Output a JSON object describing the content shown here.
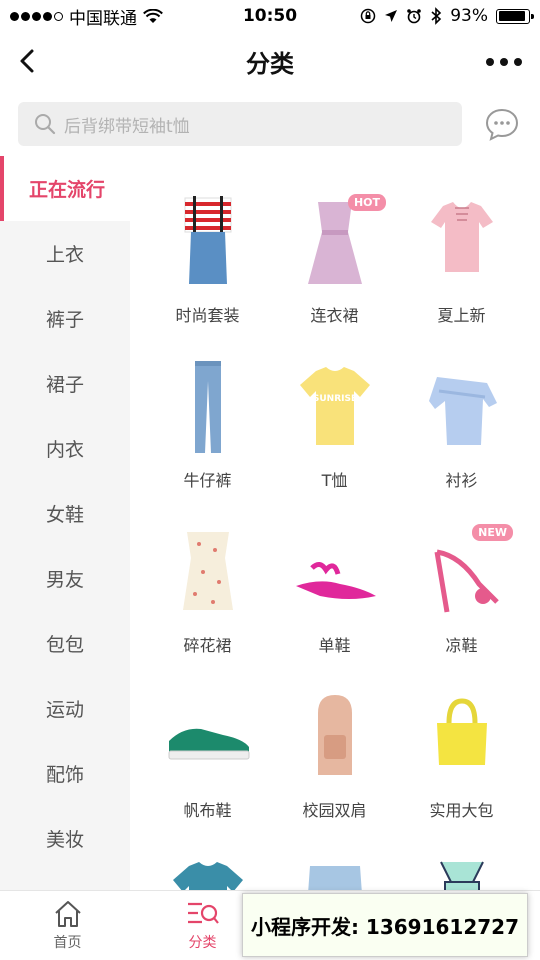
{
  "status_bar": {
    "carrier": "中国联通",
    "time": "10:50",
    "battery": "93%",
    "battery_level": 0.93
  },
  "nav": {
    "title": "分类"
  },
  "search": {
    "placeholder": "后背绑带短袖t恤"
  },
  "sidebar": {
    "items": [
      {
        "label": "正在流行",
        "active": true
      },
      {
        "label": "上衣"
      },
      {
        "label": "裤子"
      },
      {
        "label": "裙子"
      },
      {
        "label": "内衣"
      },
      {
        "label": "女鞋"
      },
      {
        "label": "男友"
      },
      {
        "label": "包包"
      },
      {
        "label": "运动"
      },
      {
        "label": "配饰"
      },
      {
        "label": "美妆"
      }
    ]
  },
  "grid": {
    "items": [
      {
        "label": "时尚套装",
        "icon": "outfit-icon"
      },
      {
        "label": "连衣裙",
        "icon": "dress-icon",
        "tag": "HOT"
      },
      {
        "label": "夏上新",
        "icon": "pink-top-icon"
      },
      {
        "label": "牛仔裤",
        "icon": "jeans-icon"
      },
      {
        "label": "T恤",
        "icon": "tshirt-icon"
      },
      {
        "label": "衬衫",
        "icon": "shirt-icon"
      },
      {
        "label": "碎花裙",
        "icon": "floral-dress-icon"
      },
      {
        "label": "单鞋",
        "icon": "flat-shoe-icon"
      },
      {
        "label": "凉鞋",
        "icon": "sandal-icon",
        "tag": "NEW"
      },
      {
        "label": "帆布鞋",
        "icon": "sneaker-icon"
      },
      {
        "label": "校园双肩",
        "icon": "backpack-icon"
      },
      {
        "label": "实用大包",
        "icon": "handbag-icon"
      }
    ]
  },
  "tabbar": {
    "items": [
      {
        "label": "首页",
        "icon": "home-icon"
      },
      {
        "label": "分类",
        "icon": "category-icon",
        "active": true
      }
    ]
  },
  "promo": {
    "text": "小程序开发: 13691612727"
  },
  "colors": {
    "accent": "#e4456a",
    "sidebar_bg": "#f5f5f5",
    "search_bg": "#eeeeee"
  }
}
